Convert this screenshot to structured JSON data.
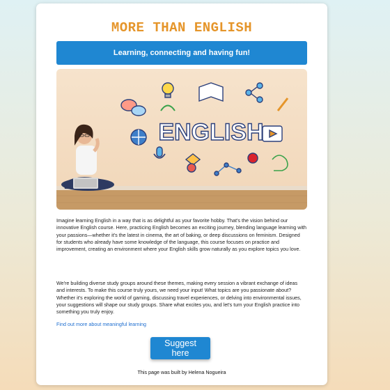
{
  "header": {
    "title": "MORE THAN ENGLISH",
    "banner": "Learning, connecting and having fun!"
  },
  "hero": {
    "word": "ENGLISH"
  },
  "content": {
    "paragraph1": "Imagine learning English in a way that is as delightful as your favorite hobby. That's the vision behind our innovative English course. Here, practicing English becomes an exciting journey, blending language learning with your passions—whether it's the latest in cinema, the art of baking, or deep discussions on feminism. Designed for students who already have some knowledge of the language, this course focuses on practice and improvement, creating an environment where your English skills grow naturally as you explore topics you love.",
    "paragraph2": "We're building diverse study groups around these themes, making every session a vibrant exchange of ideas and interests. To make this course truly yours, we need your input! What topics are you passionate about? Whether it's exploring the world of gaming, discussing travel experiences, or delving into environmental issues, your suggestions will shape our study groups. Share what excites you, and let's turn your English practice into something you truly enjoy.",
    "link": "Find out more about meaningful learning"
  },
  "cta": {
    "label": "Suggest here"
  },
  "footer": {
    "text": "This page was built by Helena Nogueira"
  },
  "colors": {
    "accent": "#1f87d2",
    "title": "#e5952a"
  }
}
